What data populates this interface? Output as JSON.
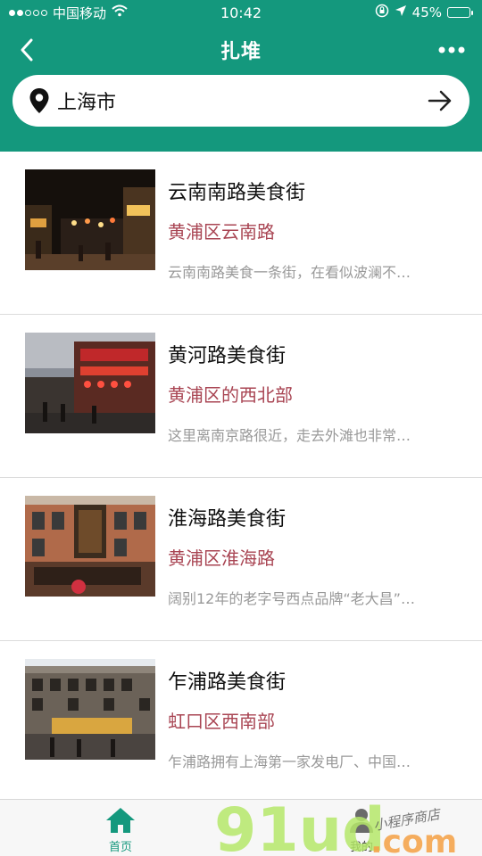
{
  "status_bar": {
    "carrier": "中国移动",
    "time": "10:42",
    "battery": "45%",
    "battery_level": 0.45
  },
  "nav": {
    "title": "扎堆",
    "back_icon": "chevron-left-icon",
    "more_icon": "more-dots-icon"
  },
  "search": {
    "value": "上海市",
    "icon": "location-pin-icon",
    "go_icon": "arrow-right-icon"
  },
  "items": [
    {
      "title": "云南南路美食街",
      "location": "黄浦区云南路",
      "desc": "云南南路美食一条街，在看似波澜不…"
    },
    {
      "title": "黄河路美食街",
      "location": "黄浦区的西北部",
      "desc": "这里离南京路很近，走去外滩也非常…"
    },
    {
      "title": "淮海路美食街",
      "location": "黄浦区淮海路",
      "desc": "阔别12年的老字号西点品牌“老大昌”…"
    },
    {
      "title": "乍浦路美食街",
      "location": "虹口区西南部",
      "desc": "乍浦路拥有上海第一家发电厂、中国…"
    }
  ],
  "tabs": [
    {
      "label": "首页",
      "icon": "home-icon",
      "active": true
    },
    {
      "label": "我的",
      "icon": "user-icon",
      "active": false
    }
  ],
  "watermark": {
    "brand": "91ud",
    "suffix": ".com",
    "tagline": "小程序商店"
  },
  "colors": {
    "brand_green": "#14987d",
    "location_red": "#a94553",
    "desc_gray": "#999999"
  }
}
